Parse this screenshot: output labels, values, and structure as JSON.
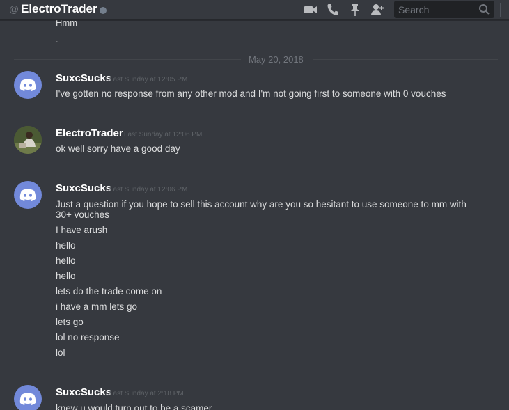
{
  "header": {
    "at_symbol": "@",
    "channel_name": "ElectroTrader",
    "search_placeholder": "Search",
    "icons": [
      "video-icon",
      "phone-icon",
      "pin-icon",
      "add-friend-icon",
      "search-icon"
    ]
  },
  "top_fragment": {
    "line1": "Hmm",
    "line2": "."
  },
  "date_divider": "May 20, 2018",
  "messages": [
    {
      "username": "SuxcSucks",
      "timestamp": "Last Sunday at 12:05 PM",
      "avatar": "discord-logo",
      "lines": [
        "I've gotten no response from any other mod and I'm not going first to someone with 0 vouches"
      ]
    },
    {
      "username": "ElectroTrader",
      "timestamp": "Last Sunday at 12:06 PM",
      "avatar": "photo",
      "lines": [
        "ok well sorry have a good day"
      ]
    },
    {
      "username": "SuxcSucks",
      "timestamp": "Last Sunday at 12:06 PM",
      "avatar": "discord-logo",
      "lines": [
        "Just a question if you hope to sell this account why are you so hesitant to use someone to mm with",
        "30+ vouches",
        "I have arush",
        "hello",
        "hello",
        "hello",
        "lets do the trade come on",
        "i have a mm lets go",
        "lets go",
        "lol no response",
        "lol"
      ]
    },
    {
      "username": "SuxcSucks",
      "timestamp": "Last Sunday at 2:18 PM",
      "avatar": "discord-logo",
      "lines": [
        "knew u would turn out to be a scamer"
      ]
    }
  ],
  "colors": {
    "background": "#36393f",
    "header_text": "#ffffff",
    "username": "#ffffff",
    "message_text": "#dcddde",
    "timestamp": "#5f6368",
    "discord_blurple": "#7289da"
  }
}
